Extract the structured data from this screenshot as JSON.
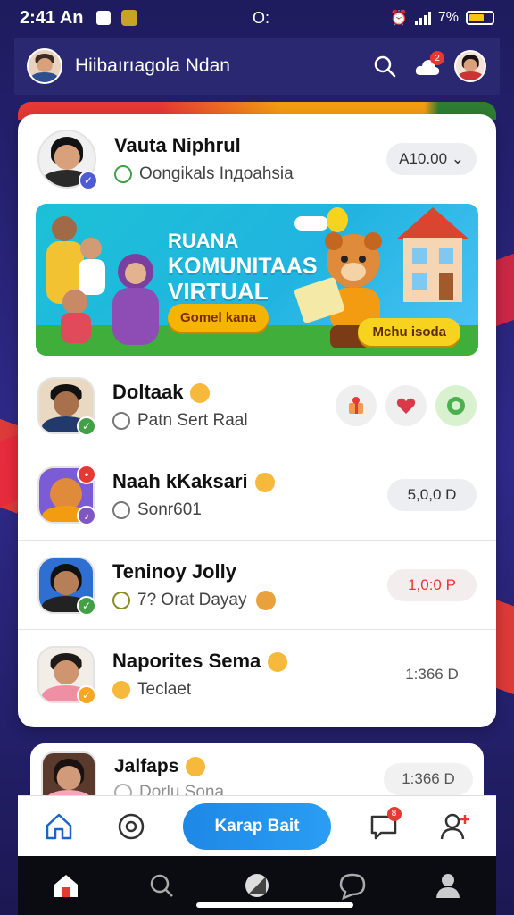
{
  "status_bar": {
    "time": "2:41 An",
    "center_text": "O:",
    "battery_text": "7%"
  },
  "header": {
    "title": "Hiibaırıagola Ndan",
    "notification_count": "2"
  },
  "profile": {
    "name": "Vauta Niphrul",
    "subtitle": "Oongikals Inдoahsia",
    "pill_text": "A10.00 ⌄"
  },
  "banner": {
    "title_line1": "RUANA",
    "title_line2": "KOMUNITAAS",
    "title_line3": "VIRTUAL",
    "cta_left": "Gomel kana",
    "cta_right": "Mchu isoda"
  },
  "list": [
    {
      "name": "Doltaak",
      "subtitle": "Patn Sert Raal",
      "value": ""
    },
    {
      "name": "Naah kKaksari",
      "subtitle": "Sonr601",
      "value": "5,0,0 D"
    },
    {
      "name": "Teninoy Jolly",
      "subtitle": "7? Orat Dayay",
      "value": "1,0:0 P"
    },
    {
      "name": "Naporites Sema",
      "subtitle": "Teclaet",
      "value": "1:366 D"
    }
  ],
  "partial_card": {
    "name": "Jalfaps",
    "subtitle": "Dorlu Sona",
    "value": "1:366 D"
  },
  "bottom_tabs": {
    "cta_label": "Karap Bait",
    "message_badge": "8"
  },
  "colors": {
    "accent_blue": "#1e88e5",
    "header_bg": "#2a2870",
    "stripe_red": "#e53935",
    "stripe_orange": "#f39c12",
    "stripe_green": "#2e7d32",
    "success_green": "#43a047"
  }
}
